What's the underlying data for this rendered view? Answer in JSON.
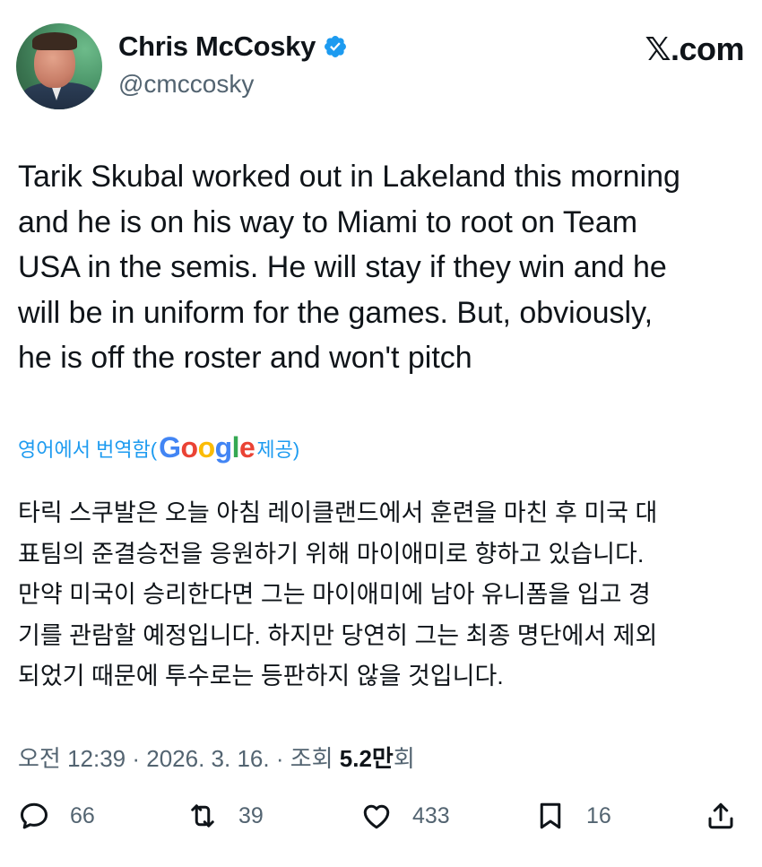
{
  "author": {
    "display_name": "Chris McCosky",
    "handle": "@cmccosky",
    "verified": true
  },
  "site_logo": {
    "mark": "𝕏",
    "text": ".com"
  },
  "tweet": {
    "lines": [
      "Tarik Skubal worked out in Lakeland this morning",
      "and he is on his way to Miami to root on Team",
      "USA in the semis. He will stay if they win and he",
      "will be in uniform for the games. But, obviously,",
      "he is off the roster and won't pitch"
    ]
  },
  "translation": {
    "prefix": "영어에서 번역함(",
    "provider": "Google",
    "suffix": " 제공)",
    "lines": [
      "타릭 스쿠발은 오늘 아침 레이클랜드에서 훈련을 마친 후 미국 대",
      "표팀의 준결승전을 응원하기 위해 마이애미로 향하고 있습니다.",
      "만약 미국이 승리한다면 그는 마이애미에 남아 유니폼을 입고 경",
      "기를 관람할 예정입니다. 하지만 당연히 그는 최종 명단에서 제외",
      "되었기 때문에 투수로는 등판하지 않을 것입니다."
    ]
  },
  "meta": {
    "time": "오전 12:39",
    "separator1": " · ",
    "date": "2026. 3. 16.",
    "separator2": " · ",
    "views_label": "조회 ",
    "views_value": "5.2만",
    "views_suffix": "회"
  },
  "actions": {
    "replies": "66",
    "reposts": "39",
    "likes": "433",
    "bookmarks": "16"
  },
  "colors": {
    "text": "#0f1419",
    "secondary": "#536471",
    "accent": "#1d9bf0"
  }
}
